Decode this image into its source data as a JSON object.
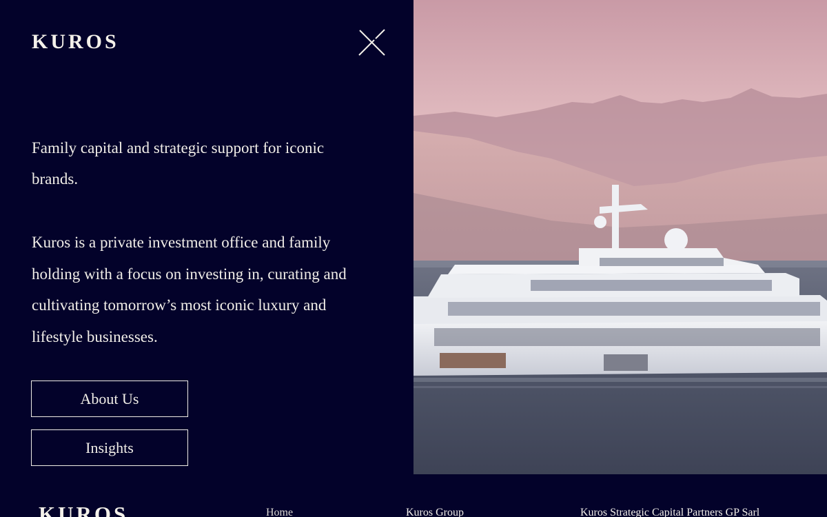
{
  "brand": {
    "logo_text": "KUROS"
  },
  "menu": {
    "close_icon": "close-icon",
    "tagline": "Family capital and strategic support for iconic brands.",
    "description": "Kuros is a private investment office and family holding with a focus on investing in, curating and cultivating tomorrow’s most iconic luxury and lifestyle businesses.",
    "buttons": {
      "about": "About Us",
      "insights": "Insights"
    }
  },
  "hero": {
    "image": "superyacht-on-lake-with-mountains-at-dusk"
  },
  "footer": {
    "logo_text": "KUROS",
    "links": {
      "home": "Home",
      "group": "Kuros Group",
      "partners": "Kuros Strategic Capital Partners GP Sarl"
    }
  },
  "colors": {
    "background": "#03022a",
    "text": "#f1eee8"
  }
}
